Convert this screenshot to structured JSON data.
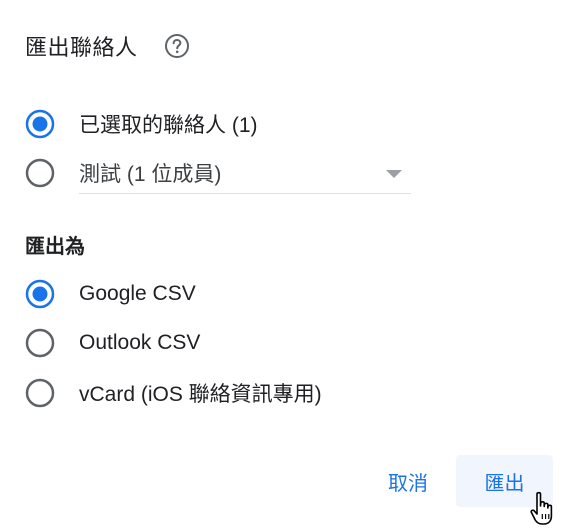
{
  "dialog": {
    "title": "匯出聯絡人",
    "help_icon": "help-circle-icon"
  },
  "contacts_source": {
    "options": [
      {
        "label": "已選取的聯絡人 (1)",
        "selected": true
      },
      {
        "label": "",
        "selected": false
      }
    ],
    "label_select": {
      "value": "測試 (1 位成員)",
      "arrow_icon": "dropdown-arrow-icon"
    }
  },
  "export_as": {
    "heading": "匯出為",
    "options": [
      {
        "label": "Google CSV",
        "selected": true
      },
      {
        "label": "Outlook CSV",
        "selected": false
      },
      {
        "label": "vCard (iOS 聯絡資訊專用)",
        "selected": false
      }
    ]
  },
  "actions": {
    "cancel_label": "取消",
    "export_label": "匯出"
  },
  "colors": {
    "accent": "#1a73e8",
    "radio_unselected": "#5f6368",
    "text": "#202124"
  }
}
